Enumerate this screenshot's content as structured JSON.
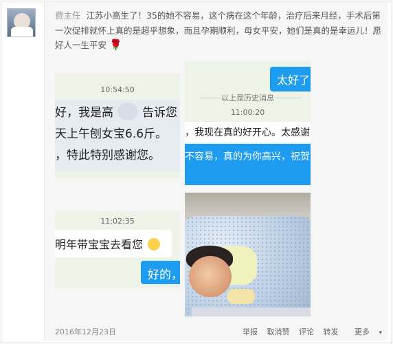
{
  "post": {
    "author": "费主任",
    "text": "江苏小高生了！35的她不容易，这个病在这个年龄，治疗后来月经，手术后第一次促排就怀上真的是超乎想象，而且孕期顺利，母女平安，她们是真的是幸运儿！愿好人一生平安",
    "emoji": "🌹"
  },
  "chat1": {
    "time": "10:54:50",
    "line1": "好，我是高",
    "line1b": "告诉您",
    "line2": "天上午刨女宝6.6斤。",
    "line3": "，特此特别感谢您。"
  },
  "chat2": {
    "reply": "太好了，",
    "history_notice": "以上是历史消息",
    "time": "11:00:20",
    "line1": "，我现在真的好开心。太感谢",
    "line2": "不容易，真的为你高兴，祝贺"
  },
  "chat3": {
    "time": "11:02:35",
    "message": "明年带宝宝去看您",
    "reply": "好的，"
  },
  "footer": {
    "date": "2016年12月23日",
    "actions": [
      "举报",
      "取消赞",
      "评论",
      "转发"
    ],
    "more": "更多",
    "more_icon": "chevron-down-icon"
  }
}
